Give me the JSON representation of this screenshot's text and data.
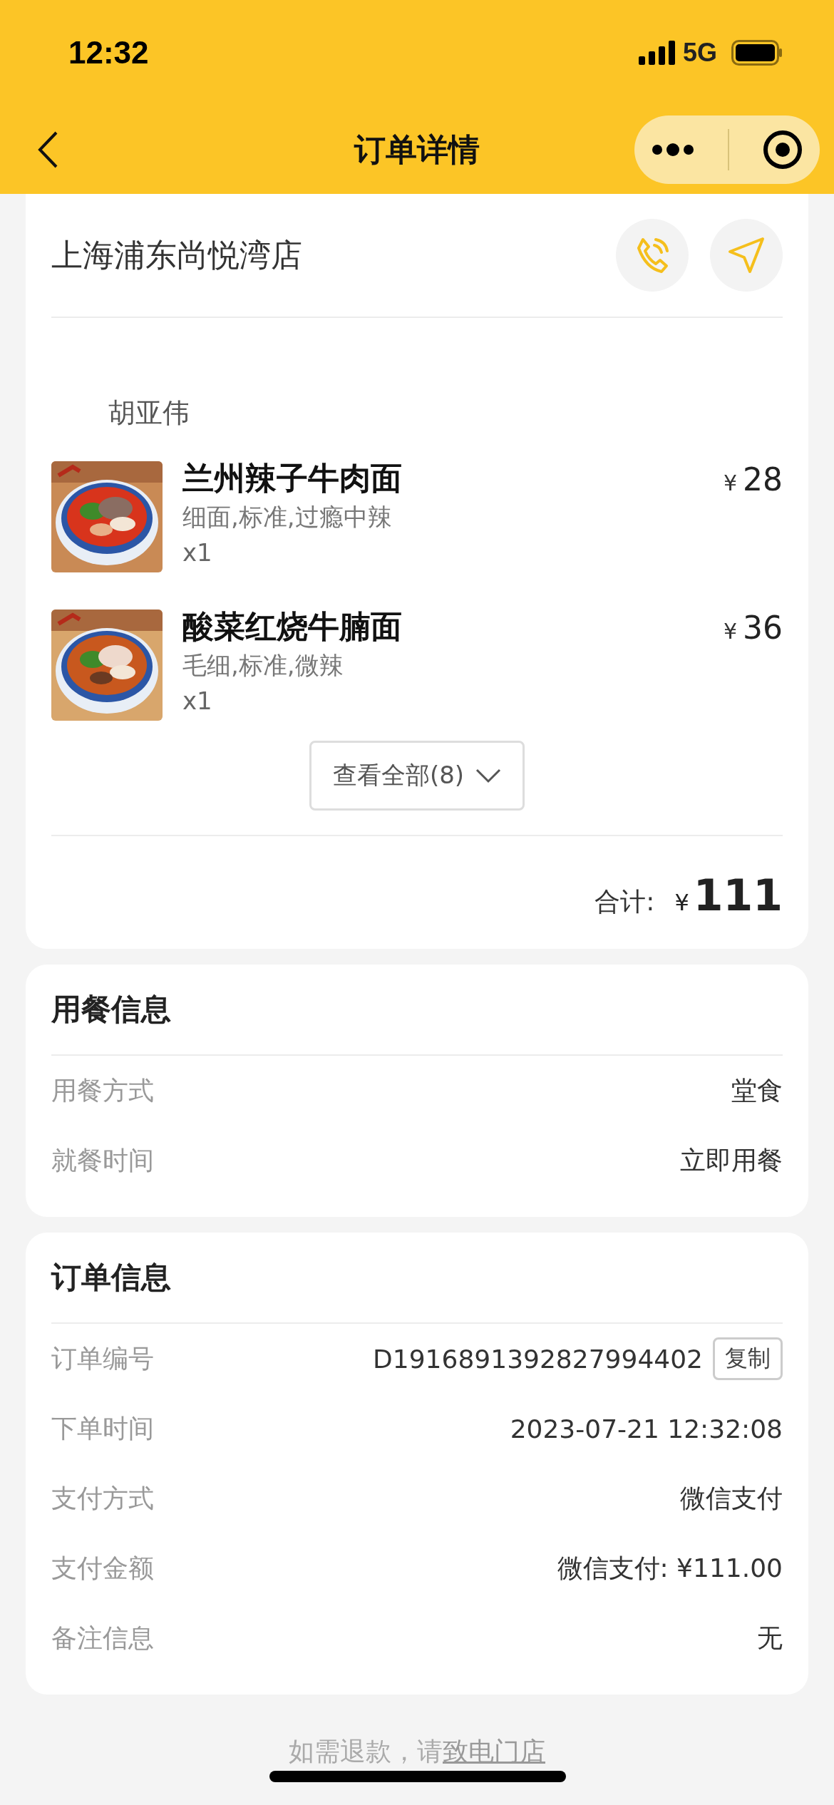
{
  "status_bar": {
    "time": "12:32",
    "network": "5G"
  },
  "nav": {
    "title": "订单详情"
  },
  "store": {
    "name": "上海浦东尚悦湾店",
    "customer": "胡亚伟",
    "items": [
      {
        "name": "兰州辣子牛肉面",
        "options": "细面,标准,过瘾中辣",
        "qty": "x1",
        "currency": "¥",
        "price": "28"
      },
      {
        "name": "酸菜红烧牛腩面",
        "options": "毛细,标准,微辣",
        "qty": "x1",
        "currency": "¥",
        "price": "36"
      }
    ],
    "view_all": "查看全部(8)",
    "total_label": "合计:",
    "total_currency": "¥",
    "total": "111"
  },
  "dining": {
    "title": "用餐信息",
    "rows": [
      {
        "label": "用餐方式",
        "value": "堂食"
      },
      {
        "label": "就餐时间",
        "value": "立即用餐"
      }
    ]
  },
  "order": {
    "title": "订单信息",
    "rows": [
      {
        "label": "订单编号",
        "value": "D1916891392827994402",
        "action": "复制"
      },
      {
        "label": "下单时间",
        "value": "2023-07-21 12:32:08"
      },
      {
        "label": "支付方式",
        "value": "微信支付"
      },
      {
        "label": "支付金额",
        "value": "微信支付: ¥111.00"
      },
      {
        "label": "备注信息",
        "value": "无"
      }
    ]
  },
  "footer": {
    "text": "如需退款，请",
    "link": "致电门店"
  }
}
